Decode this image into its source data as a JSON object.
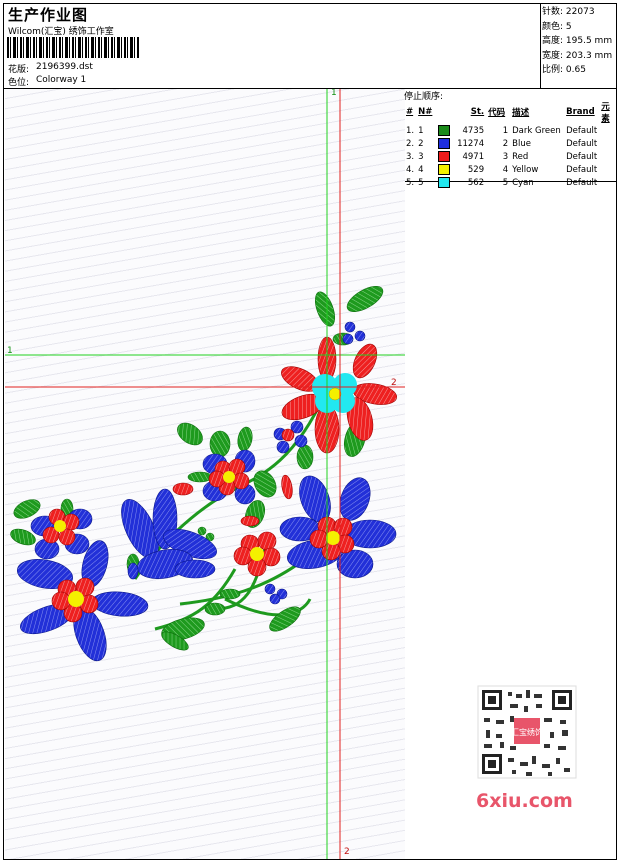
{
  "header": {
    "title": "生产作业图",
    "company": "Wilcom(汇宝) 绣饰工作室",
    "design_label": "花版:",
    "design_value": "2196399.dst",
    "color_label": "色位:",
    "color_value": "Colorway 1"
  },
  "info": {
    "stitches_label": "针数:",
    "stitches_value": "22073",
    "colors_label": "颜色:",
    "colors_value": "5",
    "height_label": "高度:",
    "height_value": "195.5 mm",
    "width_label": "宽度:",
    "width_value": "203.3 mm",
    "scale_label": "比例:",
    "scale_value": "0.65"
  },
  "stop_sequence": {
    "title": "停止顺序:",
    "columns": [
      "#",
      "N#",
      "St.",
      "代码",
      "描述",
      "Brand",
      "元素"
    ],
    "rows": [
      {
        "idx": "1.",
        "n": "1",
        "color": "#1a8a1a",
        "st": "4735",
        "code": "1",
        "desc": "Dark Green",
        "brand": "Default"
      },
      {
        "idx": "2.",
        "n": "2",
        "color": "#1e2ee0",
        "st": "11274",
        "code": "2",
        "desc": "Blue",
        "brand": "Default"
      },
      {
        "idx": "3.",
        "n": "3",
        "color": "#ee1b1b",
        "st": "4971",
        "code": "3",
        "desc": "Red",
        "brand": "Default"
      },
      {
        "idx": "4.",
        "n": "4",
        "color": "#f4f000",
        "st": "529",
        "code": "4",
        "desc": "Yellow",
        "brand": "Default"
      },
      {
        "idx": "5.",
        "n": "5",
        "color": "#22e8f0",
        "st": "562",
        "code": "5",
        "desc": "Cyan",
        "brand": "Default"
      }
    ]
  },
  "guides": {
    "green_top": "1",
    "green_left": "1",
    "red_right": "2",
    "red_bottom": "2"
  },
  "watermark": {
    "site": "6xiu.com",
    "stamp": "汇宝绣饰"
  }
}
